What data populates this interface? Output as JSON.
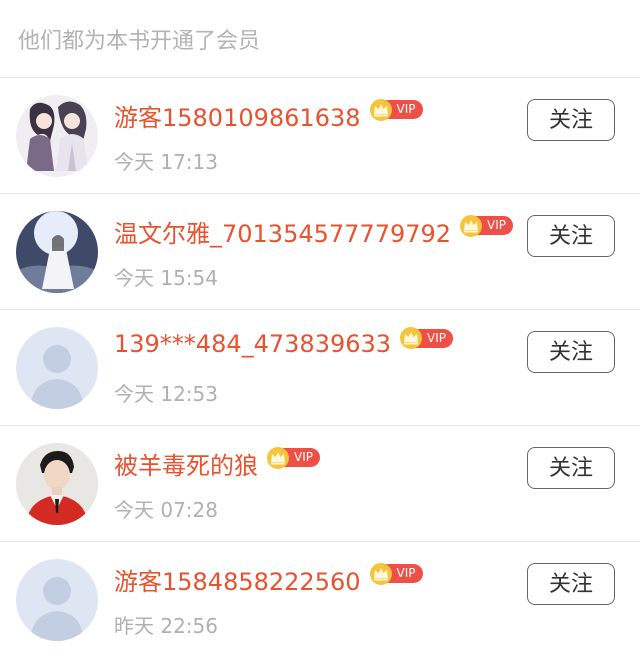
{
  "header": {
    "title": "他们都为本书开通了会员"
  },
  "colors": {
    "username": "#e8522e",
    "vip_badge": "#f04f45",
    "crown": "#f5c43a",
    "muted_text": "#b0b0b0"
  },
  "members": [
    {
      "name": "游客1580109861638",
      "time": "今天 17:13",
      "vip": "VIP",
      "follow": "关注",
      "avatar": "anime-couple-avatar"
    },
    {
      "name": "温文尔雅_701354577779792",
      "time": "今天 15:54",
      "vip": "VIP",
      "follow": "关注",
      "avatar": "white-dress-moon-avatar"
    },
    {
      "name": "139***484_473839633",
      "time": "今天 12:53",
      "vip": "VIP",
      "follow": "关注",
      "avatar": "default-person-avatar"
    },
    {
      "name": "被羊毒死的狼",
      "time": "今天 07:28",
      "vip": "VIP",
      "follow": "关注",
      "avatar": "red-suit-man-avatar"
    },
    {
      "name": "游客1584858222560",
      "time": "昨天 22:56",
      "vip": "VIP",
      "follow": "关注",
      "avatar": "default-person-avatar"
    }
  ]
}
